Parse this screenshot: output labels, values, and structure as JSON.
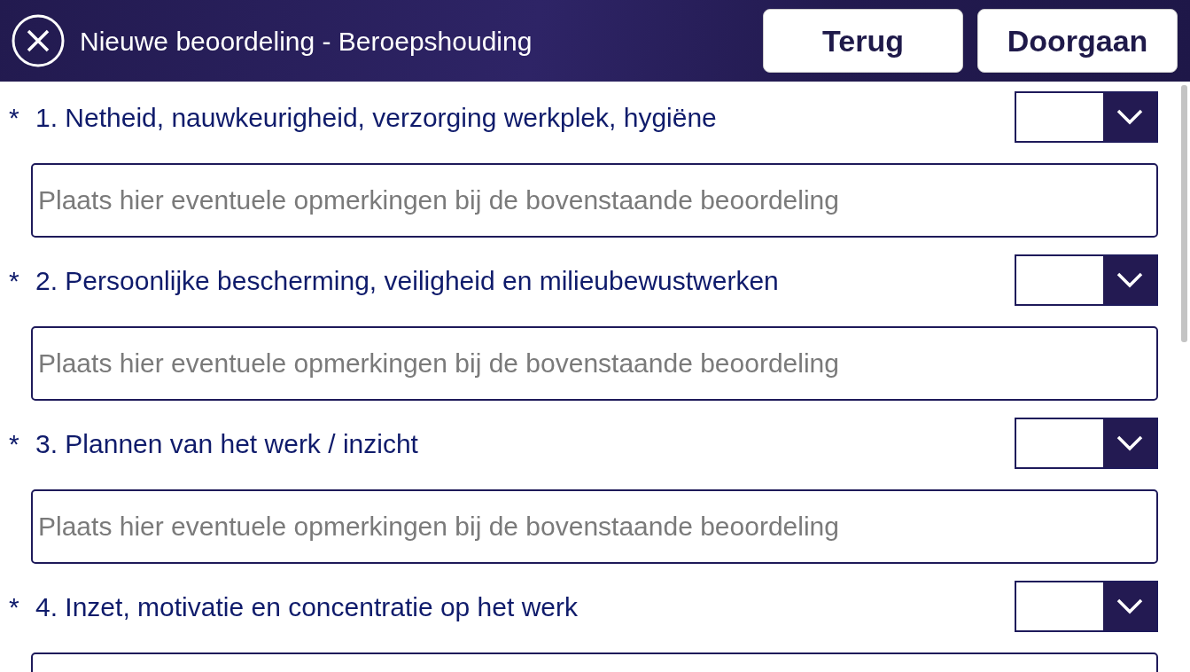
{
  "header": {
    "title": "Nieuwe beoordeling - Beroepshouding",
    "buttons": [
      {
        "label": "Terug"
      },
      {
        "label": "Doorgaan"
      }
    ]
  },
  "questions": [
    {
      "required_mark": "*",
      "label": "1. Netheid, nauwkeurigheid, verzorging werkplek, hygiëne",
      "placeholder": "Plaats hier eventuele opmerkingen bij de bovenstaande beoordeling"
    },
    {
      "required_mark": "*",
      "label": "2. Persoonlijke bescherming, veiligheid en milieubewustwerken",
      "placeholder": "Plaats hier eventuele opmerkingen bij de bovenstaande beoordeling"
    },
    {
      "required_mark": "*",
      "label": "3. Plannen van het werk / inzicht",
      "placeholder": "Plaats hier eventuele opmerkingen bij de bovenstaande beoordeling"
    },
    {
      "required_mark": "*",
      "label": "4. Inzet, motivatie en concentratie op het werk"
    }
  ]
}
